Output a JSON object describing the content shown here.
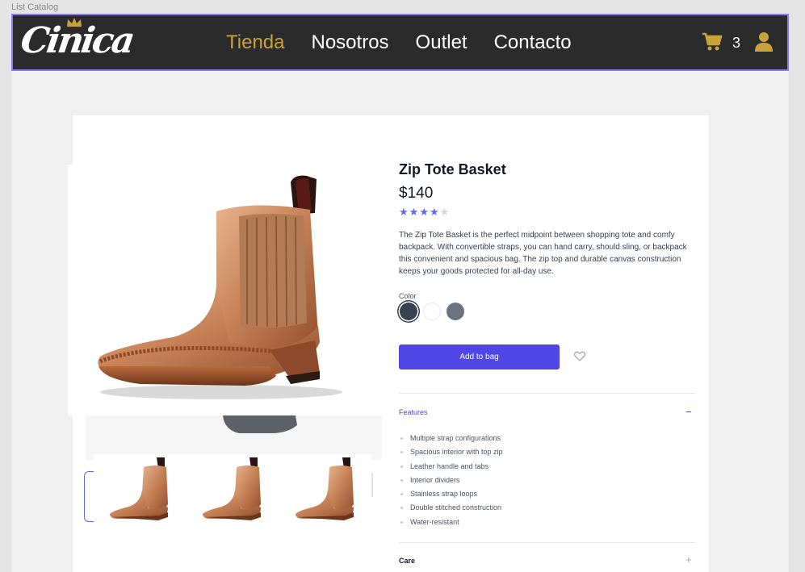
{
  "frame": {
    "label": "List Catalog"
  },
  "navbar": {
    "logo_text": "Cinica",
    "links": [
      "Tienda",
      "Nosotros",
      "Outlet",
      "Contacto"
    ],
    "cart_count": "3",
    "accent_color": "#c9a23a",
    "icons": [
      "crown-icon",
      "cart-icon",
      "user-icon"
    ]
  },
  "product": {
    "title": "Zip Tote Basket",
    "price": "$140",
    "rating": 4,
    "rating_max": 5,
    "description": "The Zip Tote Basket is the perfect midpoint between shopping tote and comfy backpack. With convertible straps, you can hand carry, should sling, or backpack this convenient and spacious bag. The zip top and durable canvas construction keeps your goods protected for all-day use.",
    "color_label": "Color",
    "colors": [
      "#374151",
      "#ffffff",
      "#6b7280"
    ],
    "add_to_bag": "Add to bag"
  },
  "features": {
    "heading": "Features",
    "toggle": "−",
    "items": [
      "Multiple strap configurations",
      "Spacious interior with top zip",
      "Leather handle and tabs",
      "Interior dividers",
      "Stainless strap loops",
      "Double stitched construction",
      "Water-resistant"
    ]
  },
  "care": {
    "heading": "Care",
    "toggle": "+"
  }
}
